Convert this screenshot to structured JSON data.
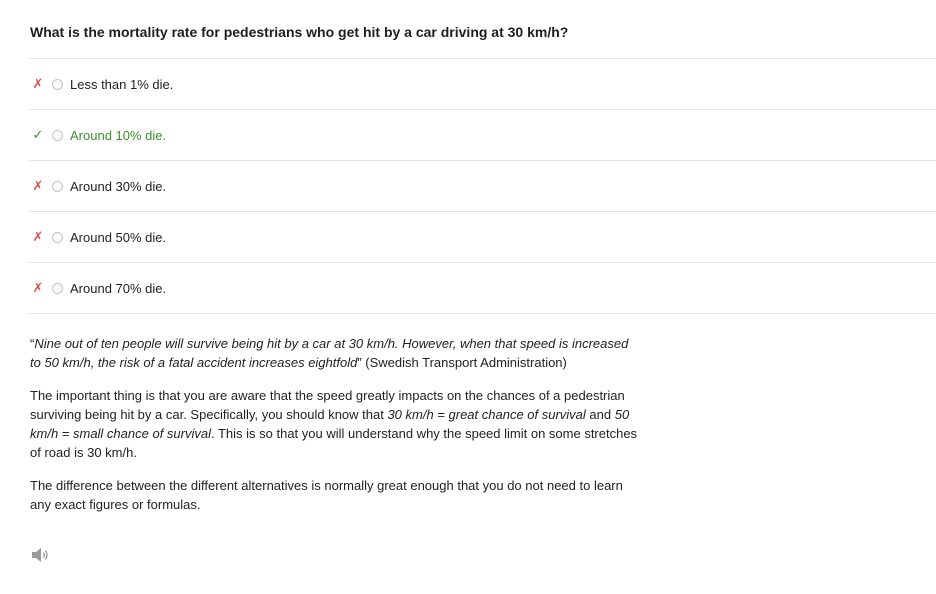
{
  "question": "What is the mortality rate for pedestrians who get hit by a car driving at 30 km/h?",
  "options": [
    {
      "mark": "✗",
      "label": "Less than 1% die."
    },
    {
      "mark": "✓",
      "label": "Around 10% die."
    },
    {
      "mark": "✗",
      "label": "Around 30% die."
    },
    {
      "mark": "✗",
      "label": "Around 50% die."
    },
    {
      "mark": "✗",
      "label": "Around 70% die."
    }
  ],
  "explanation": {
    "quote_open": "“",
    "quote_italic": "Nine out of ten people will survive being hit by a car at 30 km/h. However, when that speed is increased to 50 km/h, the risk of a fatal accident increases eightfold",
    "quote_close": "” (Swedish Transport Administration)",
    "p2_a": "The important thing is that you are aware that the speed greatly impacts on the chances of a pedestrian surviving being hit by a car. Specifically, you should know that ",
    "p2_b": "30 km/h = great chance of survival",
    "p2_c": " and ",
    "p2_d": "50 km/h = small chance of survival",
    "p2_e": ". This is so that you will understand why the speed limit on some stretches of road is 30 km/h.",
    "p3": "The difference between the different alternatives is normally great enough that you do not need to learn any exact figures or formulas."
  },
  "colors": {
    "correct": "#3c8d2f",
    "wrong": "#d9534f"
  },
  "icons": {
    "speaker": "speaker-icon"
  }
}
